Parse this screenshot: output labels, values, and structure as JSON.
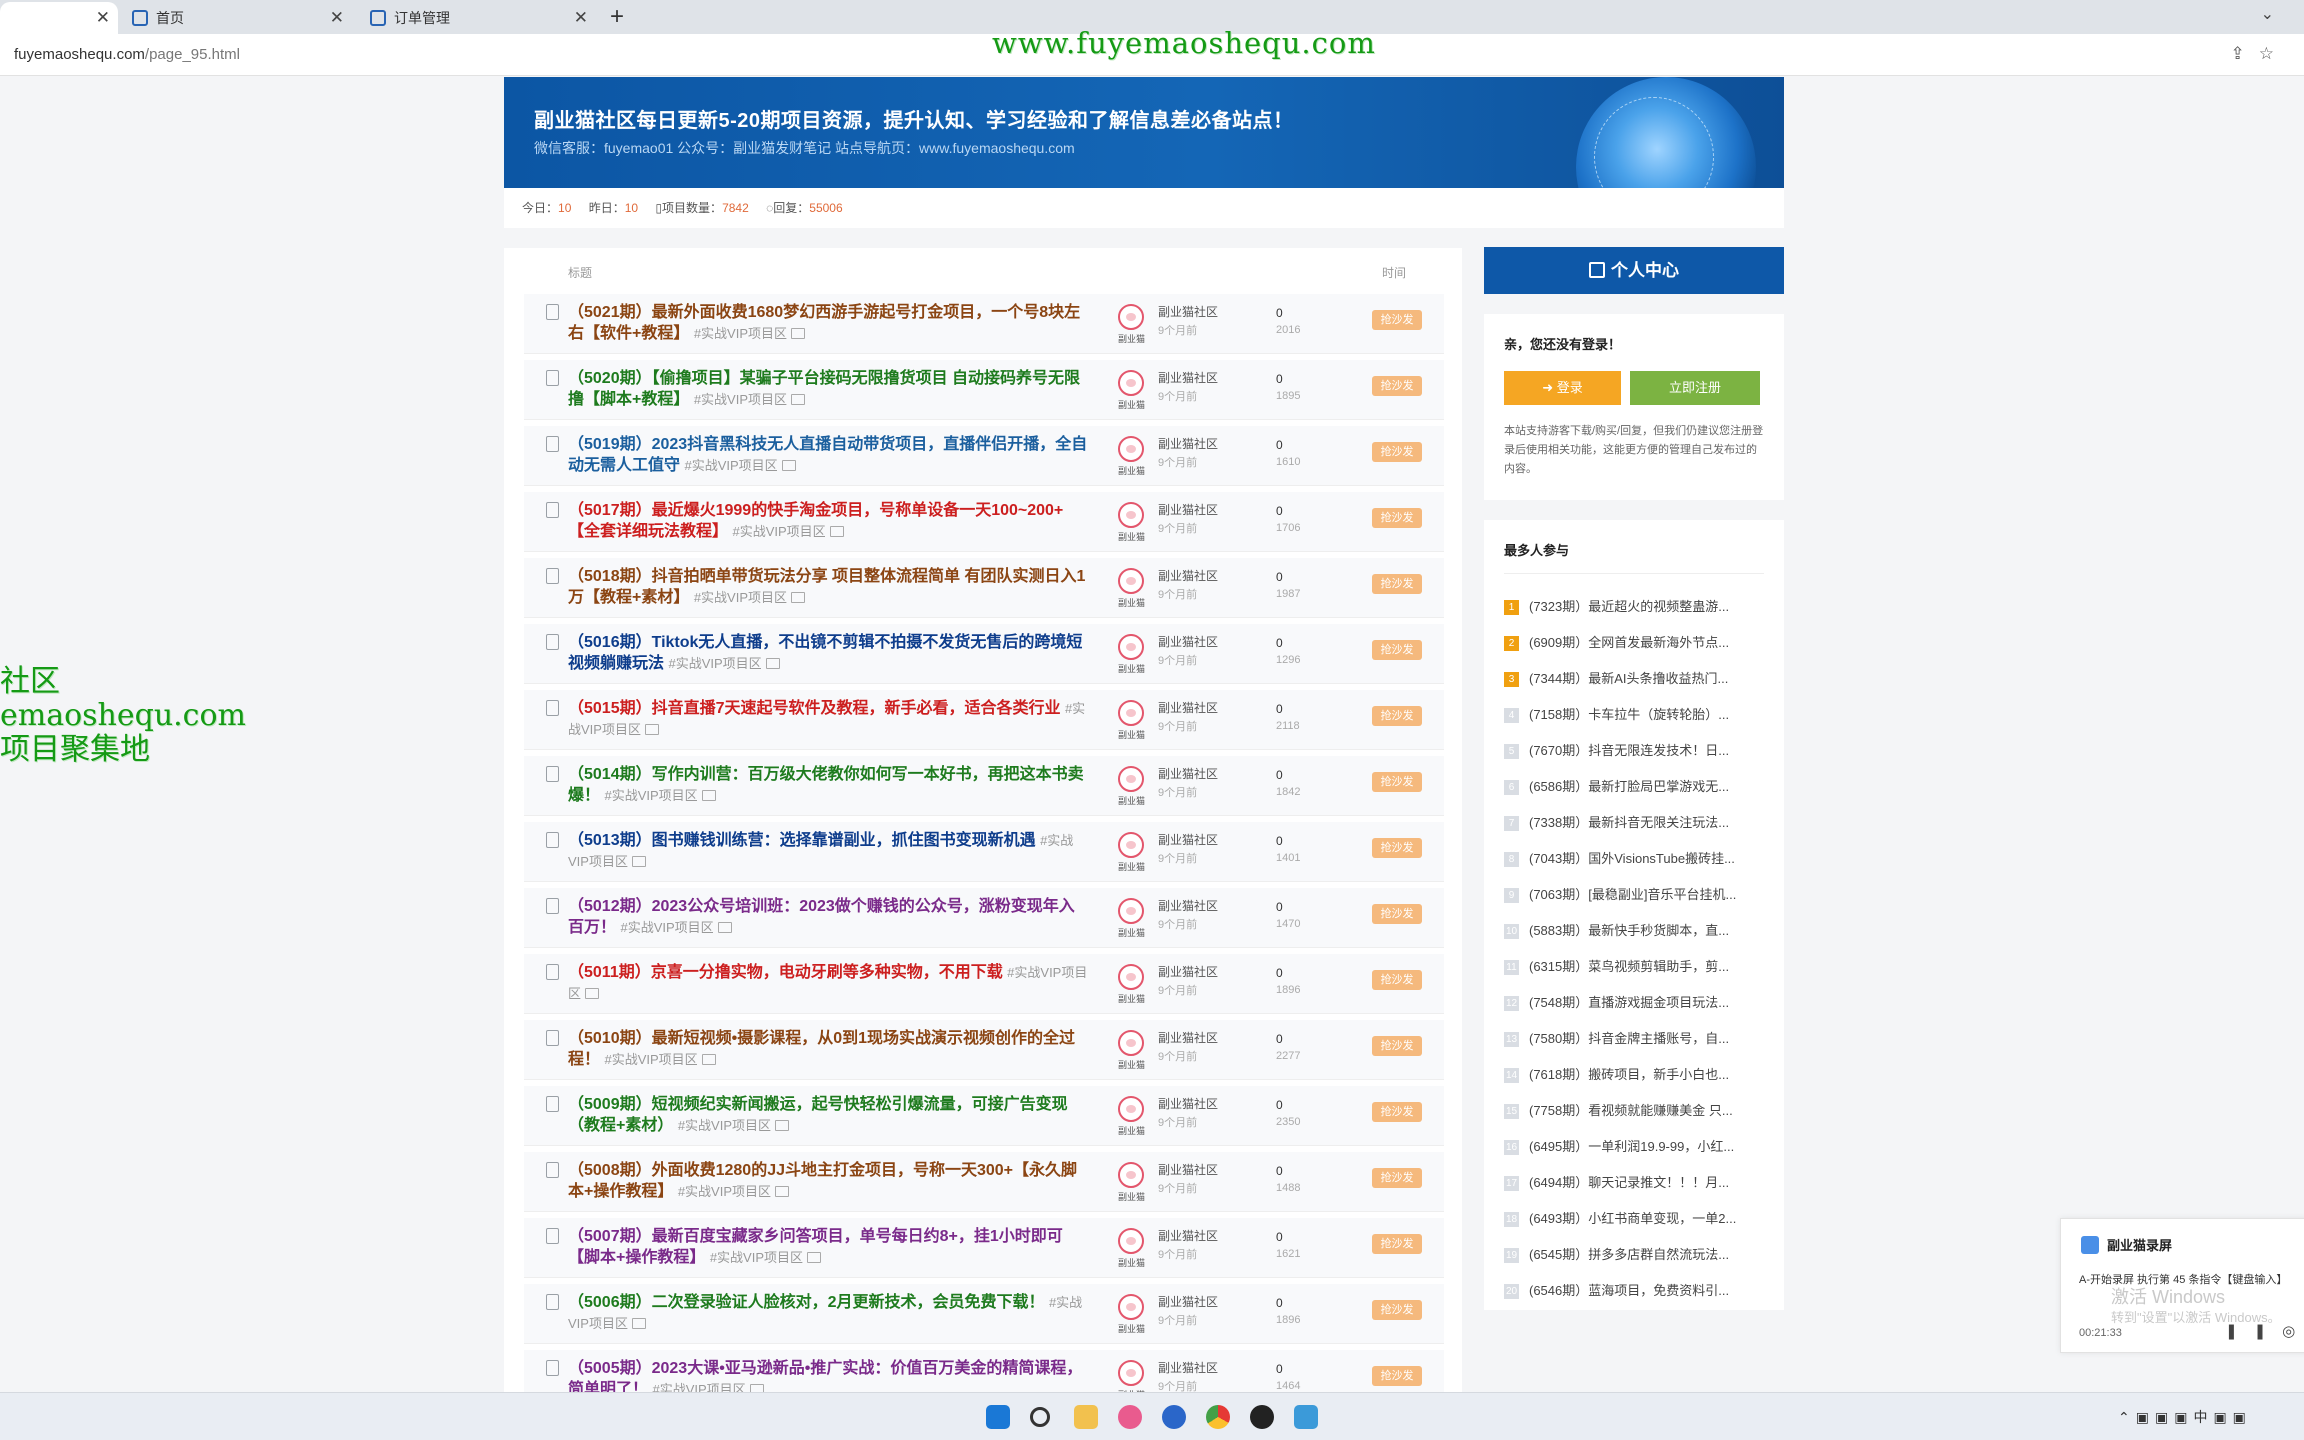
{
  "browser": {
    "tabs": [
      {
        "label": ""
      },
      {
        "label": "首页"
      },
      {
        "label": "订单管理"
      }
    ],
    "new_tab": "+",
    "url_host": "fuyemaoshequ.com",
    "url_path": "/page_95.html"
  },
  "watermark": {
    "top": "www.fuyemaoshequ.com",
    "left_line1": "社区",
    "left_line2": "emaoshequ.com",
    "left_line3": "项目聚集地"
  },
  "banner": {
    "title": "副业猫社区每日更新5-20期项目资源，提升认知、学习经验和了解信息差必备站点！",
    "subtitle": "微信客服：fuyemao01 公众号：副业猫发财笔记 站点导航页：www.fuyemaoshequ.com"
  },
  "stats": {
    "today_label": "今日：",
    "today": "10",
    "yesterday_label": "昨日：",
    "yesterday": "10",
    "projects_label": "项目数量：",
    "projects": "7842",
    "replies_label": "回复：",
    "replies": "55006"
  },
  "list": {
    "col_title": "标题",
    "col_time": "时间",
    "rows": [
      {
        "title": "（5021期）最新外面收费1680梦幻西游手游起号打金项目，一个号8块左右【软件+教程】",
        "tag": "#实战VIP项目区",
        "author": "副业猫社区",
        "ago": "9个月前",
        "replies": "0",
        "views": "2016",
        "badge": "抢沙发",
        "avatar_label": "副业猫",
        "color": "#8b4513"
      },
      {
        "title": "（5020期）【偷撸项目】某骗子平台接码无限撸货项目 自动接码养号无限撸【脚本+教程】",
        "tag": "#实战VIP项目区",
        "author": "副业猫社区",
        "ago": "9个月前",
        "replies": "0",
        "views": "1895",
        "badge": "抢沙发",
        "avatar_label": "副业猫",
        "color": "#1e7b1e"
      },
      {
        "title": "（5019期）2023抖音黑科技无人直播自动带货项目，直播伴侣开播，全自动无需人工值守",
        "tag": "#实战VIP项目区",
        "author": "副业猫社区",
        "ago": "9个月前",
        "replies": "0",
        "views": "1610",
        "badge": "抢沙发",
        "avatar_label": "副业猫",
        "color": "#1b5f9e"
      },
      {
        "title": "（5017期）最近爆火1999的快手淘金项目，号称单设备一天100~200+【全套详细玩法教程】",
        "tag": "#实战VIP项目区",
        "author": "副业猫社区",
        "ago": "9个月前",
        "replies": "0",
        "views": "1706",
        "badge": "抢沙发",
        "avatar_label": "副业猫",
        "color": "#cc1f1f"
      },
      {
        "title": "（5018期）抖音拍晒单带货玩法分享 项目整体流程简单 有团队实测日入1万【教程+素材】",
        "tag": "#实战VIP项目区",
        "author": "副业猫社区",
        "ago": "9个月前",
        "replies": "0",
        "views": "1987",
        "badge": "抢沙发",
        "avatar_label": "副业猫",
        "color": "#8b4513"
      },
      {
        "title": "（5016期）Tiktok无人直播，不出镜不剪辑不拍摄不发货无售后的跨境短视频躺赚玩法",
        "tag": "#实战VIP项目区",
        "author": "副业猫社区",
        "ago": "9个月前",
        "replies": "0",
        "views": "1296",
        "badge": "抢沙发",
        "avatar_label": "副业猫",
        "color": "#0e3d8c"
      },
      {
        "title": "（5015期）抖音直播7天速起号软件及教程，新手必看，适合各类行业",
        "tag": "#实战VIP项目区",
        "author": "副业猫社区",
        "ago": "9个月前",
        "replies": "0",
        "views": "2118",
        "badge": "抢沙发",
        "avatar_label": "副业猫",
        "color": "#cc1f1f"
      },
      {
        "title": "（5014期）写作内训营：百万级大佬教你如何写一本好书，再把这本书卖爆！",
        "tag": "#实战VIP项目区",
        "author": "副业猫社区",
        "ago": "9个月前",
        "replies": "0",
        "views": "1842",
        "badge": "抢沙发",
        "avatar_label": "副业猫",
        "color": "#1e7b1e"
      },
      {
        "title": "（5013期）图书赚钱训练营：选择靠谱副业，抓住图书变现新机遇",
        "tag": "#实战VIP项目区",
        "author": "副业猫社区",
        "ago": "9个月前",
        "replies": "0",
        "views": "1401",
        "badge": "抢沙发",
        "avatar_label": "副业猫",
        "color": "#0e3d8c"
      },
      {
        "title": "（5012期）2023公众号培训班：2023做个赚钱的公众号，涨粉变现年入百万！",
        "tag": "#实战VIP项目区",
        "author": "副业猫社区",
        "ago": "9个月前",
        "replies": "0",
        "views": "1470",
        "badge": "抢沙发",
        "avatar_label": "副业猫",
        "color": "#7a2a8a"
      },
      {
        "title": "（5011期）京喜一分撸实物，电动牙刷等多种实物，不用下载",
        "tag": "#实战VIP项目区",
        "author": "副业猫社区",
        "ago": "9个月前",
        "replies": "0",
        "views": "1896",
        "badge": "抢沙发",
        "avatar_label": "副业猫",
        "color": "#cc1f1f"
      },
      {
        "title": "（5010期）最新短视频•摄影课程，从0到1现场实战演示视频创作的全过程！",
        "tag": "#实战VIP项目区",
        "author": "副业猫社区",
        "ago": "9个月前",
        "replies": "0",
        "views": "2277",
        "badge": "抢沙发",
        "avatar_label": "副业猫",
        "color": "#8b4513"
      },
      {
        "title": "（5009期）短视频纪实新闻搬运，起号快轻松引爆流量，可接广告变现（教程+素材）",
        "tag": "#实战VIP项目区",
        "author": "副业猫社区",
        "ago": "9个月前",
        "replies": "0",
        "views": "2350",
        "badge": "抢沙发",
        "avatar_label": "副业猫",
        "color": "#1e7b1e"
      },
      {
        "title": "（5008期）外面收费1280的JJ斗地主打金项目，号称一天300+【永久脚本+操作教程】",
        "tag": "#实战VIP项目区",
        "author": "副业猫社区",
        "ago": "9个月前",
        "replies": "0",
        "views": "1488",
        "badge": "抢沙发",
        "avatar_label": "副业猫",
        "color": "#8b4513"
      },
      {
        "title": "（5007期）最新百度宝藏家乡问答项目，单号每日约8+，挂1小时即可【脚本+操作教程】",
        "tag": "#实战VIP项目区",
        "author": "副业猫社区",
        "ago": "9个月前",
        "replies": "0",
        "views": "1621",
        "badge": "抢沙发",
        "avatar_label": "副业猫",
        "color": "#7a2a8a"
      },
      {
        "title": "（5006期）二次登录验证人脸核对，2月更新技术，会员免费下载！",
        "tag": "#实战VIP项目区",
        "author": "副业猫社区",
        "ago": "9个月前",
        "replies": "0",
        "views": "1896",
        "badge": "抢沙发",
        "avatar_label": "副业猫",
        "color": "#1e7b1e"
      },
      {
        "title": "（5005期）2023大课•亚马逊新品•推广实战：价值百万美金的精简课程，简单明了！",
        "tag": "#实战VIP项目区",
        "author": "副业猫社区",
        "ago": "9个月前",
        "replies": "0",
        "views": "1464",
        "badge": "抢沙发",
        "avatar_label": "副业猫",
        "color": "#7a2a8a"
      }
    ]
  },
  "sidebar": {
    "personal_center": "个人中心",
    "greeting": "亲，您还没有登录！",
    "login": "登录",
    "register": "立即注册",
    "note": "本站支持游客下载/购买/回复，但我们仍建议您注册登录后使用相关功能，这能更方便的管理自己发布过的内容。",
    "hot_title": "最多人参与",
    "hot_items": [
      {
        "rank": "1",
        "text": "(7323期）最近超火的视频整蛊游..."
      },
      {
        "rank": "2",
        "text": "(6909期）全网首发最新海外节点..."
      },
      {
        "rank": "3",
        "text": "(7344期）最新AI头条撸收益热门..."
      },
      {
        "rank": "4",
        "text": "(7158期）卡车拉牛（旋转轮胎）..."
      },
      {
        "rank": "5",
        "text": "(7670期）抖音无限连发技术！日..."
      },
      {
        "rank": "6",
        "text": "(6586期）最新打脸局巴掌游戏无..."
      },
      {
        "rank": "7",
        "text": "(7338期）最新抖音无限关注玩法..."
      },
      {
        "rank": "8",
        "text": "(7043期）国外VisionsTube搬砖挂..."
      },
      {
        "rank": "9",
        "text": "(7063期）[最稳副业]音乐平台挂机..."
      },
      {
        "rank": "10",
        "text": "(5883期）最新快手秒货脚本，直..."
      },
      {
        "rank": "11",
        "text": "(6315期）菜鸟视频剪辑助手，剪..."
      },
      {
        "rank": "12",
        "text": "(7548期）直播游戏掘金项目玩法..."
      },
      {
        "rank": "13",
        "text": "(7580期）抖音金牌主播账号，自..."
      },
      {
        "rank": "14",
        "text": "(7618期）搬砖项目，新手小白也..."
      },
      {
        "rank": "15",
        "text": "(7758期）看视频就能赚赚美金 只..."
      },
      {
        "rank": "16",
        "text": "(6495期）一单利润19.9-99，小红..."
      },
      {
        "rank": "17",
        "text": "(6494期）聊天记录推文！！！月..."
      },
      {
        "rank": "18",
        "text": "(6493期）小红书商单变现，一单2..."
      },
      {
        "rank": "19",
        "text": "(6545期）拼多多店群自然流玩法..."
      },
      {
        "rank": "20",
        "text": "(6546期）蓝海项目，免费资料引..."
      }
    ]
  },
  "notification": {
    "app": "副业猫录屏",
    "message": "A-开始录屏 执行第 45 条指令【键盘输入】",
    "activate1": "激活 Windows",
    "activate2": "转到\"设置\"以激活 Windows。",
    "time": "00:21:33"
  },
  "colors": {
    "banner": "#0e58a8",
    "badge": "#f5b97d",
    "login": "#f5a623",
    "register": "#7cb342",
    "number": "#e06a3a"
  }
}
